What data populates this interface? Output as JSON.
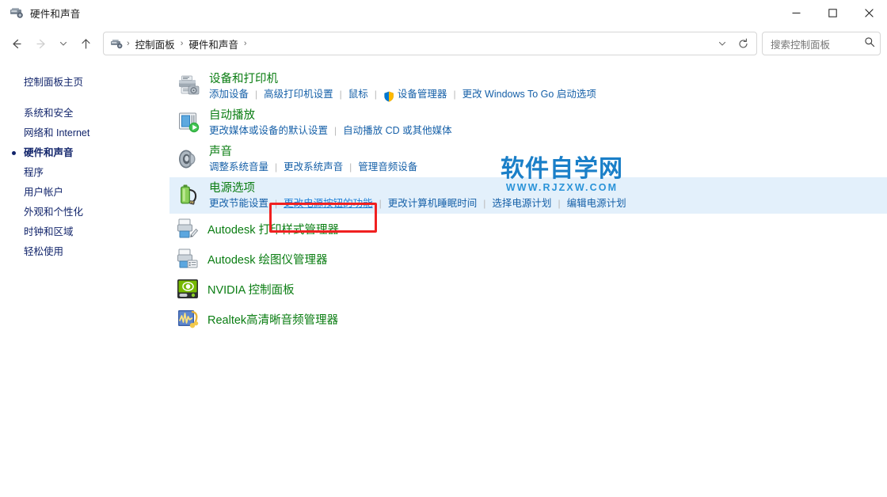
{
  "window": {
    "title": "硬件和声音",
    "title_icon": "hardware-sound-icon",
    "controls": {
      "minimize": "最小化",
      "maximize": "最大化",
      "close": "关闭"
    }
  },
  "nav": {
    "back": "后退",
    "forward": "前进",
    "recent": "最近使用的位置",
    "up": "上移一级",
    "dropdown": "历史记录",
    "refresh": "刷新"
  },
  "breadcrumb": {
    "icon": "control-panel-icon",
    "items": [
      "控制面板",
      "硬件和声音"
    ],
    "separator": "›"
  },
  "search": {
    "placeholder": "搜索控制面板",
    "icon": "search-icon"
  },
  "sidebar": {
    "home": "控制面板主页",
    "items": [
      {
        "label": "系统和安全",
        "current": false
      },
      {
        "label": "网络和 Internet",
        "current": false
      },
      {
        "label": "硬件和声音",
        "current": true
      },
      {
        "label": "程序",
        "current": false
      },
      {
        "label": "用户帐户",
        "current": false
      },
      {
        "label": "外观和个性化",
        "current": false
      },
      {
        "label": "时钟和区域",
        "current": false
      },
      {
        "label": "轻松使用",
        "current": false
      }
    ]
  },
  "main": {
    "categories": [
      {
        "icon": "devices-printers-icon",
        "title": "设备和打印机",
        "highlight": false,
        "links": [
          {
            "label": "添加设备",
            "shield": false,
            "selected": false
          },
          {
            "label": "高级打印机设置",
            "shield": false,
            "selected": false
          },
          {
            "label": "鼠标",
            "shield": false,
            "selected": false
          },
          {
            "label": "设备管理器",
            "shield": true,
            "selected": false
          },
          {
            "label": "更改 Windows To Go 启动选项",
            "shield": false,
            "selected": false
          }
        ]
      },
      {
        "icon": "autoplay-icon",
        "title": "自动播放",
        "highlight": false,
        "links": [
          {
            "label": "更改媒体或设备的默认设置",
            "shield": false,
            "selected": false
          },
          {
            "label": "自动播放 CD 或其他媒体",
            "shield": false,
            "selected": false
          }
        ]
      },
      {
        "icon": "sound-icon",
        "title": "声音",
        "highlight": false,
        "links": [
          {
            "label": "调整系统音量",
            "shield": false,
            "selected": false
          },
          {
            "label": "更改系统声音",
            "shield": false,
            "selected": false
          },
          {
            "label": "管理音频设备",
            "shield": false,
            "selected": false
          }
        ]
      },
      {
        "icon": "power-options-icon",
        "title": "电源选项",
        "highlight": true,
        "links": [
          {
            "label": "更改节能设置",
            "shield": false,
            "selected": false
          },
          {
            "label": "更改电源按钮的功能",
            "shield": false,
            "selected": true
          },
          {
            "label": "更改计算机睡眠时间",
            "shield": false,
            "selected": false
          },
          {
            "label": "选择电源计划",
            "shield": false,
            "selected": false
          },
          {
            "label": "编辑电源计划",
            "shield": false,
            "selected": false
          }
        ]
      }
    ],
    "apps": [
      {
        "icon": "autodesk-plot-style-icon",
        "title": "Autodesk 打印样式管理器"
      },
      {
        "icon": "autodesk-plotter-icon",
        "title": "Autodesk 绘图仪管理器"
      },
      {
        "icon": "nvidia-icon",
        "title": "NVIDIA 控制面板"
      },
      {
        "icon": "realtek-audio-icon",
        "title": "Realtek高清晰音频管理器"
      }
    ]
  },
  "annotation": {
    "name": "red-highlight-box",
    "color": "#f02020",
    "target": "更改电源按钮的功能"
  },
  "watermark": {
    "main": "软件自学网",
    "sub": "WWW.RJZXW.COM",
    "color": "#1a7fc8"
  }
}
